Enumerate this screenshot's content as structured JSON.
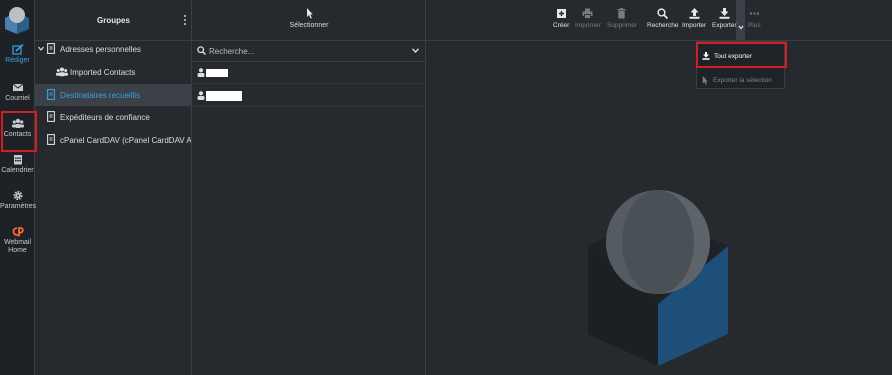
{
  "rail": {
    "items": [
      {
        "label": "Rédiger"
      },
      {
        "label": "Courriel"
      },
      {
        "label": "Contacts"
      },
      {
        "label": "Calendrier"
      },
      {
        "label": "Paramètres"
      },
      {
        "label_line1": "Webmail",
        "label_line2": "Home"
      }
    ]
  },
  "groups": {
    "title": "Groupes",
    "items": [
      {
        "label": "Adresses personnelles"
      },
      {
        "label": "Imported Contacts"
      },
      {
        "label": "Destinataires recueillis"
      },
      {
        "label": "Expéditeurs de confiance"
      },
      {
        "label": "cPanel CardDAV (cPanel CardDAV Addr..."
      }
    ]
  },
  "list": {
    "select_label": "Sélectionner",
    "search_placeholder": "Recherche..."
  },
  "toolbar": {
    "create": "Créer",
    "print": "Imprimer",
    "delete": "Supprimer",
    "search": "Recherche",
    "import": "Importer",
    "export": "Exporter",
    "more": "Plus"
  },
  "dropdown": {
    "export_all": "Tout exporter",
    "export_selection": "Exporter la sélection"
  },
  "colors": {
    "accent": "#3aa0e6",
    "highlight_box": "#d21f24",
    "background": "#262a2e"
  }
}
